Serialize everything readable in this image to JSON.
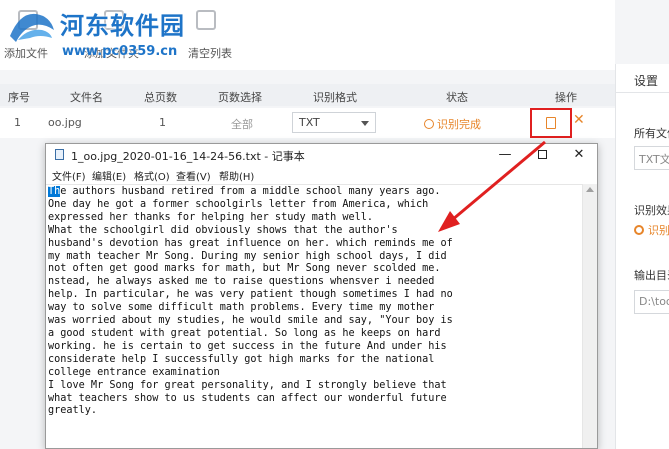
{
  "watermark": {
    "title": "河东软件园",
    "url": "www.pc0359.cn"
  },
  "toolbar": {
    "add_file": "添加文件",
    "add_folder": "添加文件夹",
    "clear_list": "清空列表"
  },
  "table": {
    "headers": [
      "序号",
      "文件名",
      "总页数",
      "页数选择",
      "识别格式",
      "状态",
      "操作"
    ],
    "rows": [
      {
        "index": "1",
        "filename": "oo.jpg",
        "pages": "1",
        "page_select": "全部",
        "format": "TXT",
        "status": "识别完成"
      }
    ]
  },
  "settings": {
    "title": "设置",
    "all_files_label": "所有文件",
    "all_files_value": "TXT文",
    "recognize_label": "识别效果",
    "recognize_option": "识别",
    "output_label": "输出目录",
    "output_value": "D:\\tool"
  },
  "notepad": {
    "title": "1_oo.jpg_2020-01-16_14-24-56.txt - 记事本",
    "menu": [
      "文件(F)",
      "编辑(E)",
      "格式(O)",
      "查看(V)",
      "帮助(H)"
    ],
    "first_line_selected": "Th",
    "first_line_rest": "e authors husband retired from a middle school many years ago.",
    "lines": [
      "One day he got a former schoolgirls letter from America, which",
      "expressed her thanks for helping her study math well.",
      "What the schoolgirl did obviously shows that the author's",
      "husband's devotion has great influence on her. which reminds me of",
      "my math teacher Mr Song. During my senior high school days, I did",
      "not often get good marks for math, but Mr Song never scolded me.",
      "nstead, he always asked me to raise questions whensver i needed",
      "help. In particular, he was very patient though sometimes I had no",
      "way to solve some difficult math problems. Every time my mother",
      "was worried about my studies, he would smile and say, \"Your boy is",
      "a good student with great potential. So long as he keeps on hard",
      "working. he is certain to get success in the future And under his",
      "considerate help I successfully got high marks for the national",
      "college entrance examination",
      "I love Mr Song for great personality, and I strongly believe that",
      "what teachers show to us students can affect our wonderful future",
      "greatly."
    ]
  },
  "colors": {
    "accent": "#e7852a",
    "highlight": "#e02020",
    "watermark": "#1e74c8"
  }
}
